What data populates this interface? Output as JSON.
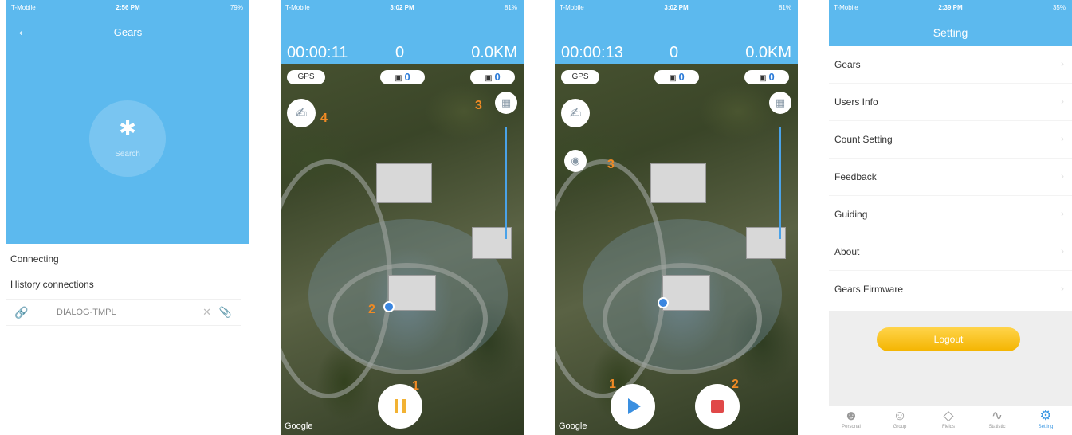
{
  "phone1": {
    "status": {
      "carrier": "T-Mobile",
      "time": "2:56 PM",
      "battery": "79%"
    },
    "title": "Gears",
    "search_label": "Search",
    "connecting_label": "Connecting",
    "history_label": "History connections",
    "device_name": "DIALOG-TMPL"
  },
  "phone2": {
    "status": {
      "carrier": "T-Mobile",
      "time": "3:02 PM",
      "battery": "81%"
    },
    "timer": "00:00:11",
    "count": "0",
    "distance": "0.0KM",
    "gps_label": "GPS",
    "pill_mid_value": "0",
    "pill_right_value": "0",
    "markers": [
      "1",
      "2",
      "3",
      "4"
    ],
    "attribution": "Google"
  },
  "phone3": {
    "status": {
      "carrier": "T-Mobile",
      "time": "3:02 PM",
      "battery": "81%"
    },
    "timer": "00:00:13",
    "count": "0",
    "distance": "0.0KM",
    "gps_label": "GPS",
    "pill_mid_value": "0",
    "pill_right_value": "0",
    "markers": [
      "1",
      "2",
      "3"
    ],
    "attribution": "Google"
  },
  "phone4": {
    "status": {
      "carrier": "T-Mobile",
      "time": "2:39 PM",
      "battery": "35%"
    },
    "title": "Setting",
    "items": [
      "Gears",
      "Users Info",
      "Count Setting",
      "Feedback",
      "Guiding",
      "About",
      "Gears Firmware"
    ],
    "logout_label": "Logout",
    "tabs": [
      "Personal",
      "Group",
      "Fields",
      "Statistic",
      "Setting"
    ]
  },
  "colors": {
    "header_blue": "#5cb9ee",
    "accent_orange": "#f08a24",
    "logout_yellow": "#f4b400",
    "tab_active": "#3a97e3"
  },
  "icons": [
    "back-arrow-icon",
    "bluetooth-icon",
    "link-icon",
    "close-icon",
    "clip-icon",
    "signature-icon",
    "map-layers-icon",
    "camera-icon",
    "pause-icon",
    "play-icon",
    "stop-icon",
    "person-icon",
    "group-icon",
    "fields-icon",
    "statistic-icon",
    "gear-icon"
  ]
}
